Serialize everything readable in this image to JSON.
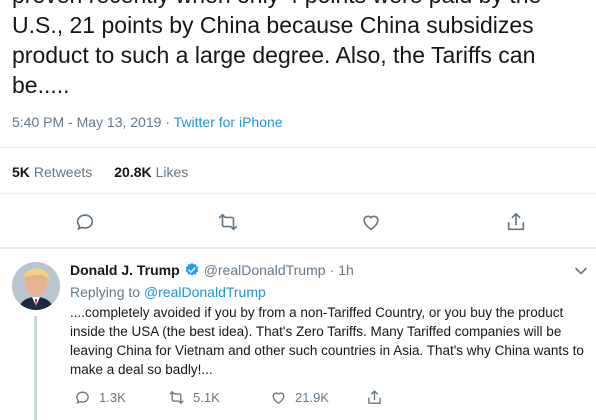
{
  "main_tweet": {
    "text": "proven recently when only 4 points were paid by the U.S., 21 points by China because China subsidizes product to such a large degree. Also, the Tariffs can be.....",
    "time": "5:40 PM - May 13, 2019",
    "separator": "·",
    "source": "Twitter for iPhone",
    "retweets_count": "5K",
    "retweets_label": "Retweets",
    "likes_count": "20.8K",
    "likes_label": "Likes"
  },
  "reply": {
    "name": "Donald J. Trump",
    "handle": "@realDonaldTrump",
    "dot": "·",
    "time": "1h",
    "replying_label": "Replying to",
    "replying_to": "@realDonaldTrump",
    "text": "....completely avoided if you by from a non-Tariffed Country, or you buy the product inside the USA (the best idea). That's Zero Tariffs. Many Tariffed companies will be leaving China for Vietnam and other such countries in Asia. That's why China wants to make a deal so badly!...",
    "replies_count": "1.3K",
    "retweets_count": "5.1K",
    "likes_count": "21.9K"
  },
  "icons": {
    "reply": "reply-icon",
    "retweet": "retweet-icon",
    "like": "heart-icon",
    "share": "share-icon",
    "verified": "verified-badge-icon",
    "caret": "chevron-down-icon"
  },
  "colors": {
    "text": "#14171a",
    "secondary": "#657786",
    "link": "#1b95e0",
    "divider": "#e6ecf0"
  }
}
